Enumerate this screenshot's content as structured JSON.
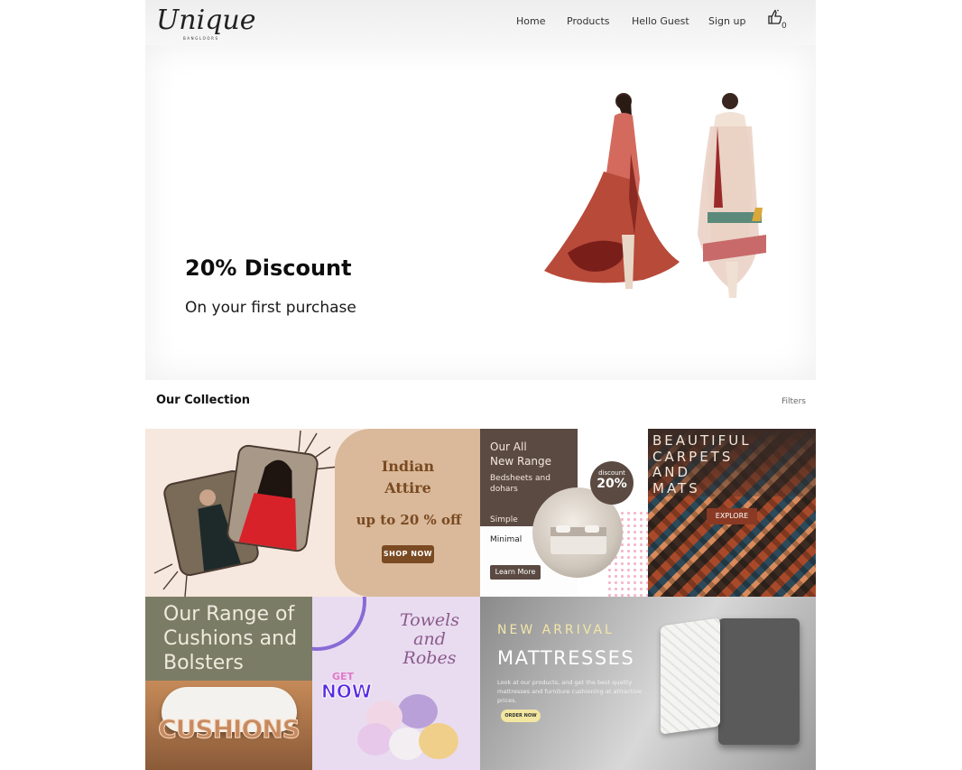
{
  "header": {
    "logo_text": "Unique",
    "logo_sub": "BANGLOORS",
    "nav": {
      "home": "Home",
      "products": "Products",
      "hello": "Hello Guest",
      "signup": "Sign up"
    },
    "cart_count": "0"
  },
  "hero": {
    "title": "20% Discount",
    "subtitle": "On your first purchase"
  },
  "collection": {
    "title": "Our Collection",
    "filters_label": "Filters"
  },
  "tiles": {
    "attire": {
      "line1": "Indian",
      "line2": "Attire",
      "offer": "up to 20 % off",
      "button": "SHOP NOW"
    },
    "bedsheets": {
      "line1": "Our All",
      "line2": "New Range",
      "line3": "Bedsheets and dohars",
      "line4": "Simple",
      "line5": "Minimal",
      "badge_small": "discount",
      "badge_big": "20%",
      "button": "Learn More"
    },
    "carpets": {
      "line1": "BEAUTIFUL",
      "line2": "CARPETS",
      "line3": "AND",
      "line4": "MATS",
      "button": "EXPLORE"
    },
    "cushions": {
      "line1": "Our Range of",
      "line2": "Cushions and",
      "line3": "Bolsters",
      "word": "CUSHIONS"
    },
    "towels": {
      "line1": "Towels",
      "line2": "and",
      "line3": "Robes",
      "get": "GET",
      "now": "NOW"
    },
    "mattresses": {
      "tag": "NEW ARRIVAL",
      "title": "MATTRESSES",
      "description": "Look at our products, and get the best quality mattresses and furniture cushioning at attractive prices.",
      "button": "ORDER NOW"
    }
  },
  "colors": {
    "accent_brown": "#7a4a22",
    "header_bg": "#f2f2f2",
    "mattress_tag": "#f2e6a8"
  },
  "icons": {
    "cart": "thumbs-up-bag-icon"
  }
}
